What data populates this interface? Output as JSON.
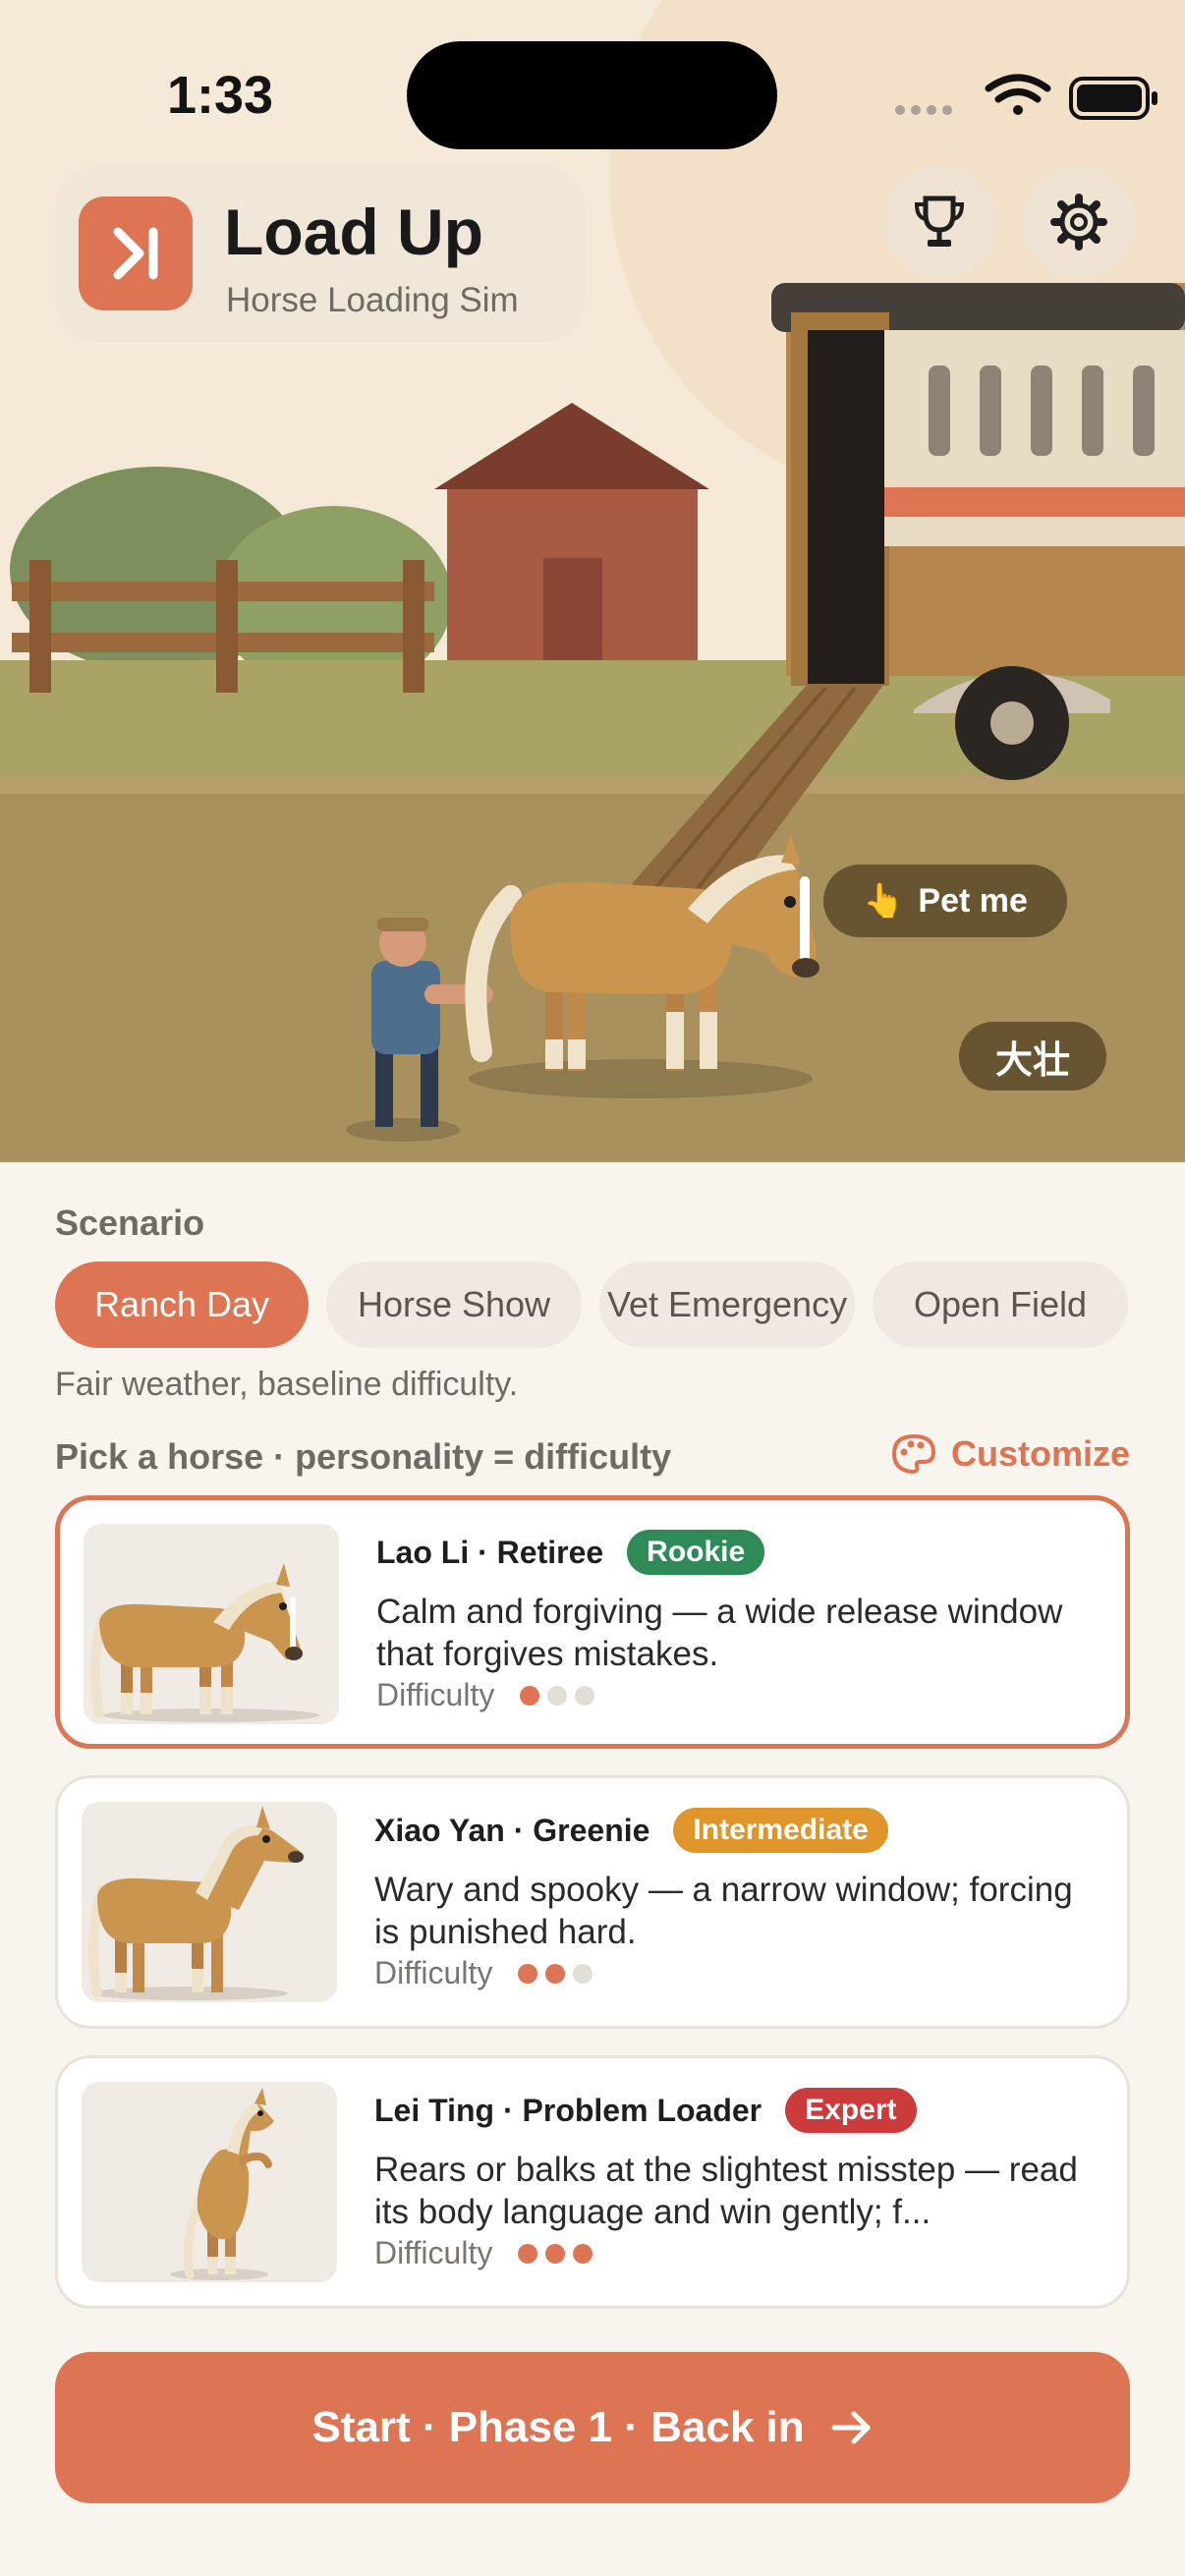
{
  "status_bar": {
    "time": "1:33"
  },
  "brand": {
    "title": "Load Up",
    "subtitle": "Horse Loading Sim",
    "icon": "skip-forward-icon"
  },
  "header_actions": {
    "trophy_icon": "trophy-icon",
    "settings_icon": "gear-icon"
  },
  "hero": {
    "pet_label": "Pet me",
    "pet_emoji": "👆",
    "horse_name": "大壮"
  },
  "scenario": {
    "label": "Scenario",
    "options": [
      "Ranch Day",
      "Horse Show",
      "Vet Emergency",
      "Open Field"
    ],
    "selected": "Ranch Day",
    "description": "Fair weather, baseline difficulty."
  },
  "horse_picker": {
    "label": "Pick a horse · personality = difficulty",
    "customize_label": "Customize",
    "difficulty_label": "Difficulty",
    "horses": [
      {
        "name": "Lao Li · Retiree",
        "level": "Rookie",
        "level_color": "#2e8b57",
        "description": "Calm and forgiving — a wide release window that forgives mistakes.",
        "difficulty": 1,
        "selected": true
      },
      {
        "name": "Xiao Yan · Greenie",
        "level": "Intermediate",
        "level_color": "#e0952a",
        "description": "Wary and spooky — a narrow window; forcing is punished hard.",
        "difficulty": 2,
        "selected": false
      },
      {
        "name": "Lei Ting · Problem Loader",
        "level": "Expert",
        "level_color": "#cc3b3b",
        "description": "Rears or balks at the slightest misstep — read its body language and win gently; f...",
        "difficulty": 3,
        "selected": false
      }
    ]
  },
  "start_button": {
    "label": "Start · Phase 1 · Back in",
    "icon": "arrow-right-icon"
  },
  "colors": {
    "accent": "#dd7453",
    "background": "#f8f4ee"
  }
}
